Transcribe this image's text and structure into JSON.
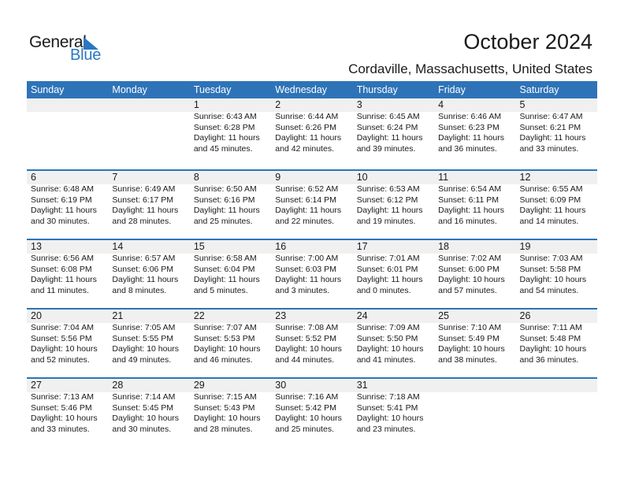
{
  "logo": {
    "line1": "General",
    "line2": "Blue",
    "icon": "triangle-flag-icon",
    "brand_color": "#2a77c0"
  },
  "header": {
    "title": "October 2024",
    "location": "Cordaville, Massachusetts, United States"
  },
  "colors": {
    "header_bg": "#2e73b8",
    "band_bg": "#f0f0f0"
  },
  "weekdays": [
    "Sunday",
    "Monday",
    "Tuesday",
    "Wednesday",
    "Thursday",
    "Friday",
    "Saturday"
  ],
  "weeks": [
    [
      {
        "day": "",
        "sunrise": "",
        "sunset": "",
        "daylight1": "",
        "daylight2": ""
      },
      {
        "day": "",
        "sunrise": "",
        "sunset": "",
        "daylight1": "",
        "daylight2": ""
      },
      {
        "day": "1",
        "sunrise": "Sunrise: 6:43 AM",
        "sunset": "Sunset: 6:28 PM",
        "daylight1": "Daylight: 11 hours",
        "daylight2": "and 45 minutes."
      },
      {
        "day": "2",
        "sunrise": "Sunrise: 6:44 AM",
        "sunset": "Sunset: 6:26 PM",
        "daylight1": "Daylight: 11 hours",
        "daylight2": "and 42 minutes."
      },
      {
        "day": "3",
        "sunrise": "Sunrise: 6:45 AM",
        "sunset": "Sunset: 6:24 PM",
        "daylight1": "Daylight: 11 hours",
        "daylight2": "and 39 minutes."
      },
      {
        "day": "4",
        "sunrise": "Sunrise: 6:46 AM",
        "sunset": "Sunset: 6:23 PM",
        "daylight1": "Daylight: 11 hours",
        "daylight2": "and 36 minutes."
      },
      {
        "day": "5",
        "sunrise": "Sunrise: 6:47 AM",
        "sunset": "Sunset: 6:21 PM",
        "daylight1": "Daylight: 11 hours",
        "daylight2": "and 33 minutes."
      }
    ],
    [
      {
        "day": "6",
        "sunrise": "Sunrise: 6:48 AM",
        "sunset": "Sunset: 6:19 PM",
        "daylight1": "Daylight: 11 hours",
        "daylight2": "and 30 minutes."
      },
      {
        "day": "7",
        "sunrise": "Sunrise: 6:49 AM",
        "sunset": "Sunset: 6:17 PM",
        "daylight1": "Daylight: 11 hours",
        "daylight2": "and 28 minutes."
      },
      {
        "day": "8",
        "sunrise": "Sunrise: 6:50 AM",
        "sunset": "Sunset: 6:16 PM",
        "daylight1": "Daylight: 11 hours",
        "daylight2": "and 25 minutes."
      },
      {
        "day": "9",
        "sunrise": "Sunrise: 6:52 AM",
        "sunset": "Sunset: 6:14 PM",
        "daylight1": "Daylight: 11 hours",
        "daylight2": "and 22 minutes."
      },
      {
        "day": "10",
        "sunrise": "Sunrise: 6:53 AM",
        "sunset": "Sunset: 6:12 PM",
        "daylight1": "Daylight: 11 hours",
        "daylight2": "and 19 minutes."
      },
      {
        "day": "11",
        "sunrise": "Sunrise: 6:54 AM",
        "sunset": "Sunset: 6:11 PM",
        "daylight1": "Daylight: 11 hours",
        "daylight2": "and 16 minutes."
      },
      {
        "day": "12",
        "sunrise": "Sunrise: 6:55 AM",
        "sunset": "Sunset: 6:09 PM",
        "daylight1": "Daylight: 11 hours",
        "daylight2": "and 14 minutes."
      }
    ],
    [
      {
        "day": "13",
        "sunrise": "Sunrise: 6:56 AM",
        "sunset": "Sunset: 6:08 PM",
        "daylight1": "Daylight: 11 hours",
        "daylight2": "and 11 minutes."
      },
      {
        "day": "14",
        "sunrise": "Sunrise: 6:57 AM",
        "sunset": "Sunset: 6:06 PM",
        "daylight1": "Daylight: 11 hours",
        "daylight2": "and 8 minutes."
      },
      {
        "day": "15",
        "sunrise": "Sunrise: 6:58 AM",
        "sunset": "Sunset: 6:04 PM",
        "daylight1": "Daylight: 11 hours",
        "daylight2": "and 5 minutes."
      },
      {
        "day": "16",
        "sunrise": "Sunrise: 7:00 AM",
        "sunset": "Sunset: 6:03 PM",
        "daylight1": "Daylight: 11 hours",
        "daylight2": "and 3 minutes."
      },
      {
        "day": "17",
        "sunrise": "Sunrise: 7:01 AM",
        "sunset": "Sunset: 6:01 PM",
        "daylight1": "Daylight: 11 hours",
        "daylight2": "and 0 minutes."
      },
      {
        "day": "18",
        "sunrise": "Sunrise: 7:02 AM",
        "sunset": "Sunset: 6:00 PM",
        "daylight1": "Daylight: 10 hours",
        "daylight2": "and 57 minutes."
      },
      {
        "day": "19",
        "sunrise": "Sunrise: 7:03 AM",
        "sunset": "Sunset: 5:58 PM",
        "daylight1": "Daylight: 10 hours",
        "daylight2": "and 54 minutes."
      }
    ],
    [
      {
        "day": "20",
        "sunrise": "Sunrise: 7:04 AM",
        "sunset": "Sunset: 5:56 PM",
        "daylight1": "Daylight: 10 hours",
        "daylight2": "and 52 minutes."
      },
      {
        "day": "21",
        "sunrise": "Sunrise: 7:05 AM",
        "sunset": "Sunset: 5:55 PM",
        "daylight1": "Daylight: 10 hours",
        "daylight2": "and 49 minutes."
      },
      {
        "day": "22",
        "sunrise": "Sunrise: 7:07 AM",
        "sunset": "Sunset: 5:53 PM",
        "daylight1": "Daylight: 10 hours",
        "daylight2": "and 46 minutes."
      },
      {
        "day": "23",
        "sunrise": "Sunrise: 7:08 AM",
        "sunset": "Sunset: 5:52 PM",
        "daylight1": "Daylight: 10 hours",
        "daylight2": "and 44 minutes."
      },
      {
        "day": "24",
        "sunrise": "Sunrise: 7:09 AM",
        "sunset": "Sunset: 5:50 PM",
        "daylight1": "Daylight: 10 hours",
        "daylight2": "and 41 minutes."
      },
      {
        "day": "25",
        "sunrise": "Sunrise: 7:10 AM",
        "sunset": "Sunset: 5:49 PM",
        "daylight1": "Daylight: 10 hours",
        "daylight2": "and 38 minutes."
      },
      {
        "day": "26",
        "sunrise": "Sunrise: 7:11 AM",
        "sunset": "Sunset: 5:48 PM",
        "daylight1": "Daylight: 10 hours",
        "daylight2": "and 36 minutes."
      }
    ],
    [
      {
        "day": "27",
        "sunrise": "Sunrise: 7:13 AM",
        "sunset": "Sunset: 5:46 PM",
        "daylight1": "Daylight: 10 hours",
        "daylight2": "and 33 minutes."
      },
      {
        "day": "28",
        "sunrise": "Sunrise: 7:14 AM",
        "sunset": "Sunset: 5:45 PM",
        "daylight1": "Daylight: 10 hours",
        "daylight2": "and 30 minutes."
      },
      {
        "day": "29",
        "sunrise": "Sunrise: 7:15 AM",
        "sunset": "Sunset: 5:43 PM",
        "daylight1": "Daylight: 10 hours",
        "daylight2": "and 28 minutes."
      },
      {
        "day": "30",
        "sunrise": "Sunrise: 7:16 AM",
        "sunset": "Sunset: 5:42 PM",
        "daylight1": "Daylight: 10 hours",
        "daylight2": "and 25 minutes."
      },
      {
        "day": "31",
        "sunrise": "Sunrise: 7:18 AM",
        "sunset": "Sunset: 5:41 PM",
        "daylight1": "Daylight: 10 hours",
        "daylight2": "and 23 minutes."
      },
      {
        "day": "",
        "sunrise": "",
        "sunset": "",
        "daylight1": "",
        "daylight2": ""
      },
      {
        "day": "",
        "sunrise": "",
        "sunset": "",
        "daylight1": "",
        "daylight2": ""
      }
    ]
  ]
}
